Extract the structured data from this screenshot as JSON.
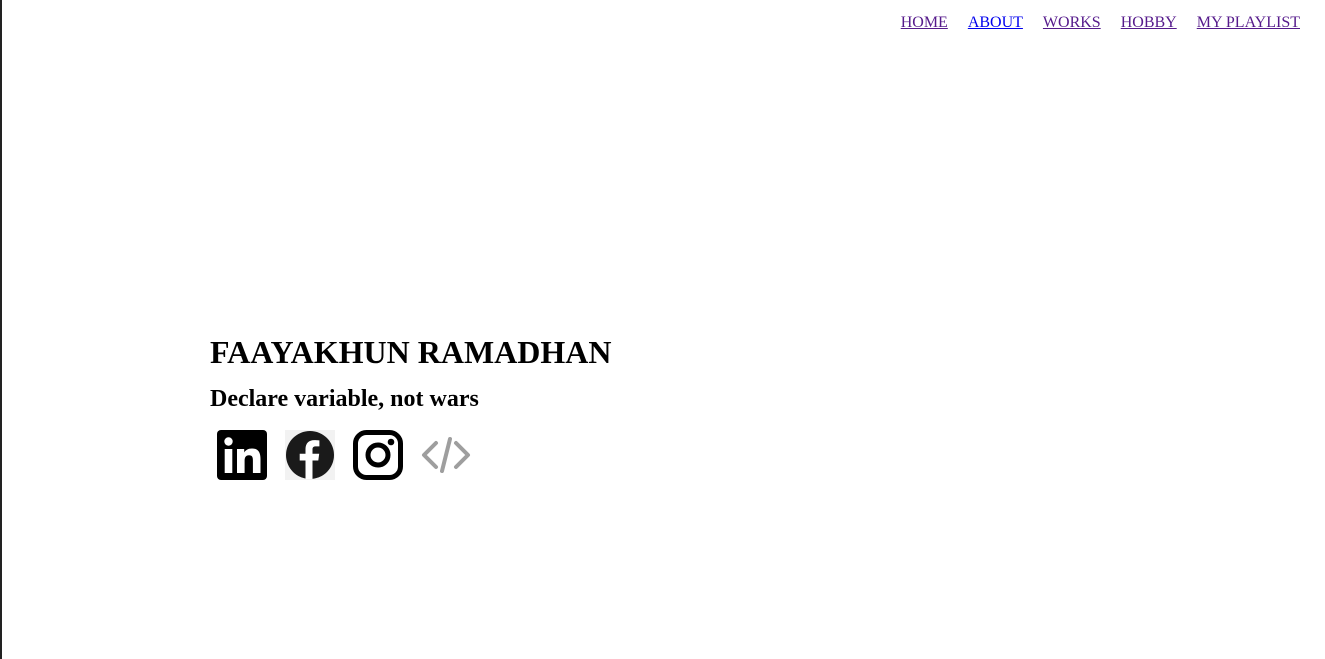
{
  "nav": {
    "items": [
      {
        "label": "HOME"
      },
      {
        "label": "ABOUT"
      },
      {
        "label": "WORKS"
      },
      {
        "label": "HOBBY"
      },
      {
        "label": "MY PLAYLIST"
      }
    ]
  },
  "hero": {
    "name": "FAAYAKHUN RAMADHAN",
    "tagline": "Declare variable, not wars"
  },
  "socials": [
    {
      "icon": "linkedin-icon"
    },
    {
      "icon": "facebook-icon"
    },
    {
      "icon": "instagram-icon"
    },
    {
      "icon": "code-icon"
    }
  ],
  "colors": {
    "visited_link": "#551a8b",
    "unvisited_link": "#0000ee",
    "code_icon": "#9e9e9e"
  }
}
